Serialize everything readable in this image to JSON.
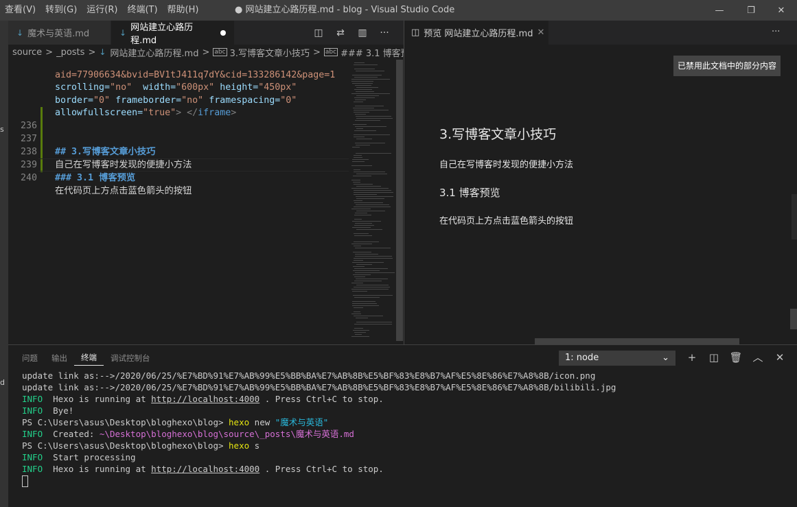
{
  "menu": [
    "查看(V)",
    "转到(G)",
    "运行(R)",
    "终端(T)",
    "帮助(H)"
  ],
  "window_title": "● 网站建立心路历程.md - blog - Visual Studio Code",
  "window_controls": {
    "minimize": "—",
    "maximize": "❐",
    "close": "✕"
  },
  "tabs": [
    {
      "label": "魔术与英语.md",
      "active": false
    },
    {
      "label": "网站建立心路历程.md",
      "active": true,
      "dirty": true
    }
  ],
  "md_icon": "↓",
  "editor_actions": [
    "◫",
    "⇄",
    "▥",
    "···"
  ],
  "breadcrumb": [
    "source",
    "_posts",
    "网站建立心路历程.md",
    "3.写博客文章小技巧",
    "### 3.1 博客预览"
  ],
  "breadcrumb_sep": ">",
  "breadcrumb_abc": "abc",
  "code": {
    "line_a": "aid=77906634&bvid=BV1tJ411q7dY&cid=133286142&page=1",
    "line_b_attr1": "scrolling=",
    "line_b_val1": "\"no\"",
    "line_b_attr2": "  width=",
    "line_b_val2": "\"600px\"",
    "line_b_attr3": " height=",
    "line_b_val3": "\"450px\"",
    "line_c_attr1": "border=",
    "line_c_val1": "\"0\"",
    "line_c_attr2": " frameborder=",
    "line_c_val2": "\"no\"",
    "line_c_attr3": " framespacing=",
    "line_c_val3": "\"0\"",
    "line_d_attr1": "allowfullscreen=",
    "line_d_val1": "\"true\"",
    "line_d_close1": "> </",
    "line_d_tag": "iframe",
    "line_d_close2": ">",
    "lines": [
      {
        "num": "236",
        "text": ""
      },
      {
        "num": "237",
        "text": "## 3.写博客文章小技巧"
      },
      {
        "num": "238",
        "text": "自己在写博客时发现的便捷小方法"
      },
      {
        "num": "239",
        "text": "### 3.1 博客预览"
      },
      {
        "num": "240",
        "text": "在代码页上方点击蓝色箭头的按钮"
      }
    ]
  },
  "preview": {
    "tab_label": "预览 网站建立心路历程.md",
    "tab_icon": "◫",
    "tab_close": "✕",
    "more": "···",
    "notice": "已禁用此文档中的部分内容",
    "h2": "3.写博客文章小技巧",
    "p1": "自己在写博客时发现的便捷小方法",
    "h3": "3.1 博客预览",
    "p2": "在代码页上方点击蓝色箭头的按钮"
  },
  "panel": {
    "tabs": [
      "问题",
      "输出",
      "终端",
      "调试控制台"
    ],
    "active_tab": "终端",
    "terminal_select": "1: node",
    "select_chevron": "⌄",
    "actions": [
      "+",
      "◫",
      "🗑",
      "︿",
      "✕"
    ]
  },
  "terminal": {
    "l1": "update link as:-->/2020/06/25/%E7%BD%91%E7%AB%99%E5%BB%BA%E7%AB%8B%E5%BF%83%E8%B7%AF%E5%8E%86%E7%A8%8B/icon.png",
    "l2": "update link as:-->/2020/06/25/%E7%BD%91%E7%AB%99%E5%BB%BA%E7%AB%8B%E5%BF%83%E8%B7%AF%E5%8E%86%E7%A8%8B/bilibili.jpg",
    "info": "INFO",
    "l3_a": "  Hexo is running at ",
    "l3_link": "http://localhost:4000",
    "l3_b": " . Press Ctrl+C to stop.",
    "l4": "  Bye!",
    "prompt": "PS C:\\Users\\asus\\Desktop\\bloghexo\\blog> ",
    "cmd_hexo": "hexo",
    "l5_new": " new ",
    "l5_arg": "\"魔术与英语\"",
    "l6_a": "  Created: ",
    "l6_path": "~\\Desktop\\bloghexo\\blog\\source\\_posts\\魔术与英语.md",
    "l7_s": " s",
    "l8": "  Start processing",
    "l9_a": "  Hexo is running at ",
    "l9_link": "http://localhost:4000",
    "l9_b": " . Press Ctrl+C to stop."
  },
  "left_marks": [
    "s",
    "d"
  ]
}
